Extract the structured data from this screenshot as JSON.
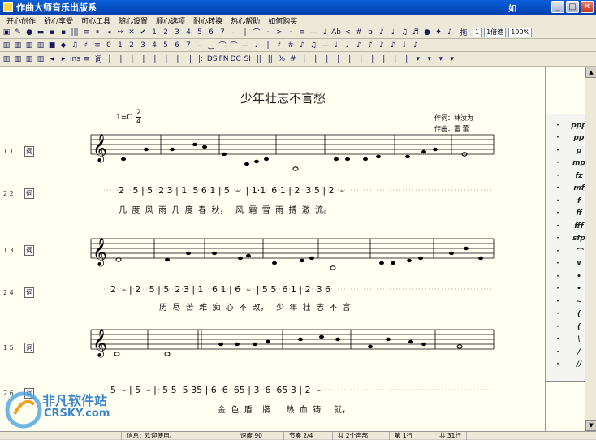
{
  "window": {
    "title": "作曲大师音乐出版系",
    "title_right": "如"
  },
  "menu": [
    "开心创作",
    "舒心享受",
    "可心工具",
    "随心设置",
    "顺心选项",
    "耐心转换",
    "热心帮助",
    "如何购买"
  ],
  "toolbar1": {
    "tools": [
      "▣",
      "✎",
      "●",
      "▬",
      "▪",
      "▪",
      "|||",
      "≡",
      "⏸",
      "◂",
      "⇔",
      "✕",
      "✔",
      "1",
      "2",
      "3",
      "4",
      "5",
      "6",
      "7",
      "–",
      "|",
      "⌒",
      "·",
      ">",
      "·",
      "≡",
      "—",
      "♩",
      "Ab",
      "<",
      "#",
      "b",
      "♪",
      "♩",
      "♫",
      "♬",
      "●",
      "♦",
      "♪"
    ],
    "zoom_label": "拖",
    "zoom_value": "1",
    "speed": "1倍速",
    "percent": "100%"
  },
  "toolbar2": {
    "tools": [
      "▥",
      "▥",
      "▥",
      "▥",
      "■",
      "◆",
      "♫",
      "♯",
      "≡",
      "0",
      "1",
      "2",
      "3",
      "4",
      "5",
      "6",
      "7",
      "–",
      "‿",
      "⌒",
      "⌒",
      "—",
      "♩",
      "|",
      "♯",
      "#",
      "♪",
      "♫",
      "—",
      "♩",
      "♩",
      "♪",
      "♪",
      "♪",
      "♪",
      "♩",
      "♪"
    ]
  },
  "toolbar3": {
    "tools": [
      "▥",
      "▥",
      "▥",
      "▥",
      "◂",
      "▸",
      "ins",
      "≡",
      "词",
      "|",
      "|",
      "|",
      "|",
      "|",
      "|",
      "|",
      "||",
      "|:",
      "DS",
      "FN",
      "DC",
      "SI",
      "||",
      "||",
      "%",
      "#",
      "|",
      "|",
      "|",
      "|",
      "|",
      "|",
      "|",
      "|",
      "|",
      "|",
      "▾",
      "▾",
      "▾",
      "▾"
    ]
  },
  "score": {
    "title": "少年壮志不言愁",
    "key": "1=C",
    "time_top": "2",
    "time_bottom": "4",
    "lyricist": "作词：林汝为",
    "composer": "作曲：雷 蕾",
    "staff_labels": [
      "1 1",
      "2 2",
      "1 3",
      "2 4",
      "1 5",
      "2 6"
    ],
    "ci": "词",
    "jianpu_rows": [
      "2   5 | 5  2 3 | 1  5 6 1 | 5  –  | 1·1  6 1 | 2  3 5 | 2  –",
      "2  – | 2   5 | 5  2 3 | 1   6 1 | 6  –  | 5 5  6 1 | 2  3 6",
      "5  – | 5  – |: 5 5  5 35 | 6  6  65 | 3  6  65 3 | 2  –"
    ],
    "lyric_rows": [
      "几  度  风  雨  几  度  春  秋，   风  霜  雪  雨  搏  激  流。",
      "历  尽  苦  难  痴  心  不  改，   少  年  壮  志  不  言",
      "金  色  盾    牌      热  血  铸     就，"
    ]
  },
  "palette": {
    "col1": [
      "·",
      "·",
      "·",
      "·",
      "·",
      "·",
      "·",
      "·",
      "·",
      "·",
      "·",
      "·",
      "·",
      "·",
      "·",
      "·",
      "·",
      "·",
      "·",
      "·"
    ],
    "col2": [
      "ppp",
      "pp",
      "p",
      "mp",
      "fz",
      "mf",
      "f",
      "ff",
      "fff",
      "sfp",
      "⌒",
      "∨",
      "•",
      "•",
      "~",
      "(",
      "(",
      "\\",
      "/",
      "//"
    ]
  },
  "status": {
    "info": "信息：欢迎使用。",
    "speed": "速度 90",
    "beat": "节奏 2/4",
    "parts": "共 2个声部",
    "row": "第 1行",
    "total": "共 31行"
  },
  "watermark": {
    "cn": "非凡软件站",
    "en": "CRSKY.com"
  },
  "colors": {
    "titlebar": "#0a5fd8",
    "canvas": "#fffff2",
    "toolbar": "#ece9d8"
  }
}
